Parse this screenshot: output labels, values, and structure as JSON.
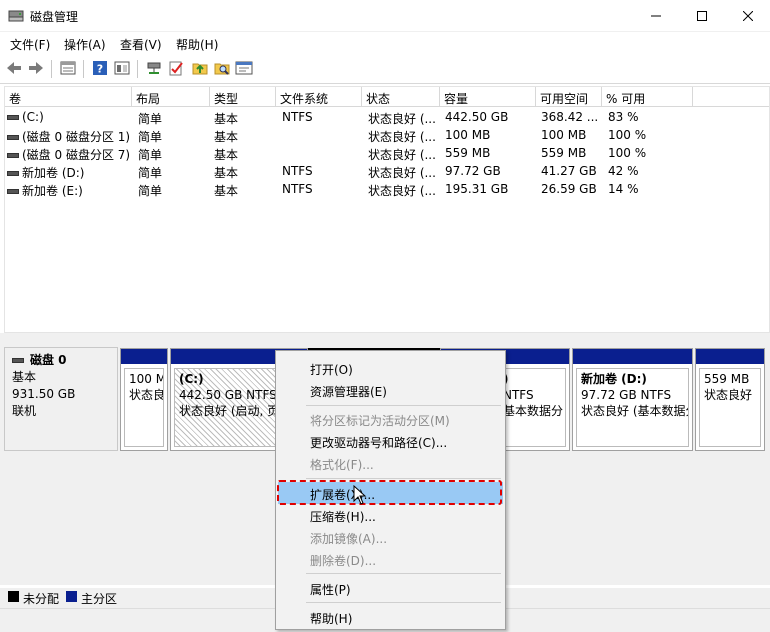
{
  "window": {
    "title": "磁盘管理"
  },
  "menu": [
    "文件(F)",
    "操作(A)",
    "查看(V)",
    "帮助(H)"
  ],
  "toolbar": {
    "icons": [
      "back-arrow-icon",
      "forward-arrow-icon",
      "properties-icon",
      "help-icon",
      "view-icon",
      "connect-icon",
      "check-icon",
      "folder-up-icon",
      "search-icon",
      "console-icon"
    ]
  },
  "volume_table": {
    "headers": [
      "卷",
      "布局",
      "类型",
      "文件系统",
      "状态",
      "容量",
      "可用空间",
      "% 可用"
    ],
    "rows": [
      [
        "(C:)",
        "简单",
        "基本",
        "NTFS",
        "状态良好 (...",
        "442.50 GB",
        "368.42 ...",
        "83 %"
      ],
      [
        "(磁盘 0 磁盘分区 1)",
        "简单",
        "基本",
        "",
        "状态良好 (...",
        "100 MB",
        "100 MB",
        "100 %"
      ],
      [
        "(磁盘 0 磁盘分区 7)",
        "简单",
        "基本",
        "",
        "状态良好 (...",
        "559 MB",
        "559 MB",
        "100 %"
      ],
      [
        "新加卷 (D:)",
        "简单",
        "基本",
        "NTFS",
        "状态良好 (...",
        "97.72 GB",
        "41.27 GB",
        "42 %"
      ],
      [
        "新加卷 (E:)",
        "简单",
        "基本",
        "NTFS",
        "状态良好 (...",
        "195.31 GB",
        "26.59 GB",
        "14 %"
      ]
    ]
  },
  "disk": {
    "name": "磁盘 0",
    "type": "基本",
    "size": "931.50 GB",
    "status": "联机",
    "partitions": [
      {
        "lines": [
          "100 M",
          "状态良"
        ]
      },
      {
        "lines": [
          "(C:)",
          "442.50 GB NTFS",
          "状态良好 (启动, 页"
        ]
      },
      {
        "lines": []
      },
      {
        "lines": [
          ")",
          "NTFS",
          "基本数据分"
        ]
      },
      {
        "lines": [
          "新加卷  (D:)",
          "97.72 GB NTFS",
          "状态良好 (基本数据分"
        ]
      },
      {
        "lines": [
          "",
          "559 MB",
          "状态良好"
        ]
      }
    ]
  },
  "legend": [
    "未分配",
    "主分区"
  ],
  "colors": {
    "unallocated": "#000000",
    "primary": "#0a1f8f",
    "highlight": "#99c9f4",
    "annotation": "#e00000"
  },
  "context_menu": [
    {
      "label": "打开(O)",
      "disabled": false
    },
    {
      "label": "资源管理器(E)",
      "disabled": false
    },
    {
      "label": "将分区标记为活动分区(M)",
      "disabled": true
    },
    {
      "label": "更改驱动器号和路径(C)...",
      "disabled": false
    },
    {
      "label": "格式化(F)...",
      "disabled": true
    },
    {
      "label": "扩展卷(X)...",
      "disabled": false,
      "highlighted": true
    },
    {
      "label": "压缩卷(H)...",
      "disabled": false
    },
    {
      "label": "添加镜像(A)...",
      "disabled": true
    },
    {
      "label": "删除卷(D)...",
      "disabled": true
    },
    {
      "label": "属性(P)",
      "disabled": false
    },
    {
      "label": "帮助(H)",
      "disabled": false
    }
  ]
}
